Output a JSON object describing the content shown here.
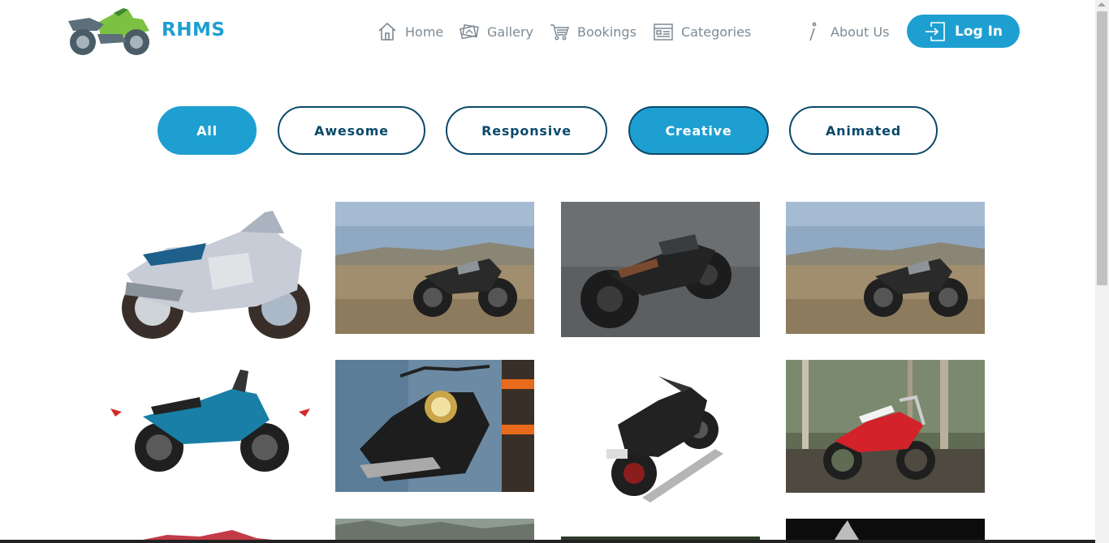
{
  "header": {
    "brand": "RHMS",
    "nav": [
      {
        "label": "Home",
        "icon": "home-icon"
      },
      {
        "label": "Gallery",
        "icon": "gallery-icon"
      },
      {
        "label": "Bookings",
        "icon": "cart-icon"
      },
      {
        "label": "Categories",
        "icon": "categories-icon"
      },
      {
        "label": "About Us",
        "icon": "info-icon"
      }
    ],
    "login_label": "Log In"
  },
  "filters": [
    {
      "label": "All",
      "active": true
    },
    {
      "label": "Awesome",
      "active": false
    },
    {
      "label": "Responsive",
      "active": false
    },
    {
      "label": "Creative",
      "active": true
    },
    {
      "label": "Animated",
      "active": false
    }
  ],
  "colors": {
    "accent": "#1e9fd1",
    "dark_border": "#0b4a6b",
    "nav_text": "#7d8a94"
  },
  "gallery": [
    {
      "name": "sport-touring-bike-illustration"
    },
    {
      "name": "cafe-racer-desert-photo"
    },
    {
      "name": "dark-cafe-racer-photo"
    },
    {
      "name": "cafe-racer-desert-photo-2"
    },
    {
      "name": "blue-street-bike-photo"
    },
    {
      "name": "cruiser-closeup-photo"
    },
    {
      "name": "black-naked-bike-photo"
    },
    {
      "name": "red-dirt-bike-photo"
    }
  ]
}
